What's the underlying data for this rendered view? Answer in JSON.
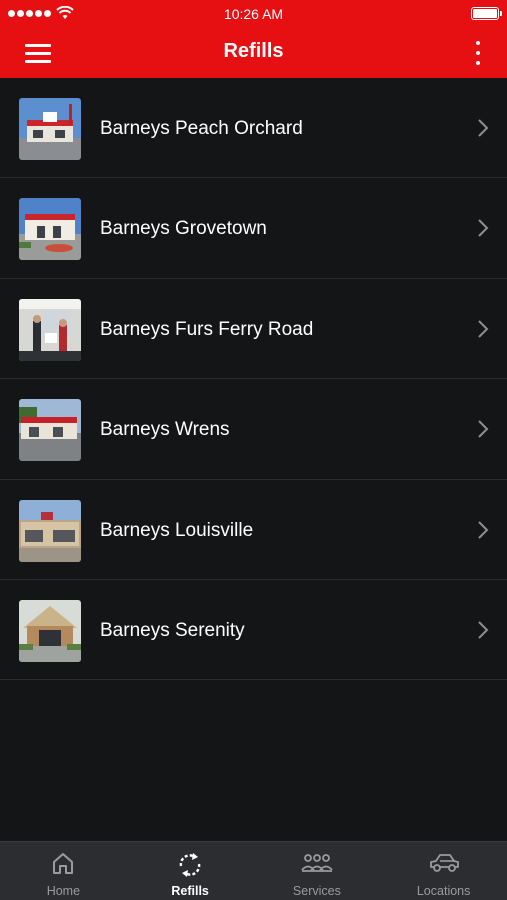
{
  "status_bar": {
    "time": "10:26 AM"
  },
  "header": {
    "title": "Refills"
  },
  "stores": [
    {
      "name": "Barneys Peach Orchard"
    },
    {
      "name": "Barneys Grovetown"
    },
    {
      "name": "Barneys Furs Ferry Road"
    },
    {
      "name": "Barneys Wrens"
    },
    {
      "name": "Barneys Louisville"
    },
    {
      "name": "Barneys Serenity"
    }
  ],
  "tabbar": {
    "items": [
      {
        "label": "Home",
        "icon": "home-icon"
      },
      {
        "label": "Refills",
        "icon": "refresh-icon"
      },
      {
        "label": "Services",
        "icon": "people-group-icon"
      },
      {
        "label": "Locations",
        "icon": "car-icon"
      }
    ],
    "active": "Refills"
  },
  "colors": {
    "brand": "#e60f12",
    "background": "#141517",
    "tabbar": "#2c2d30"
  }
}
